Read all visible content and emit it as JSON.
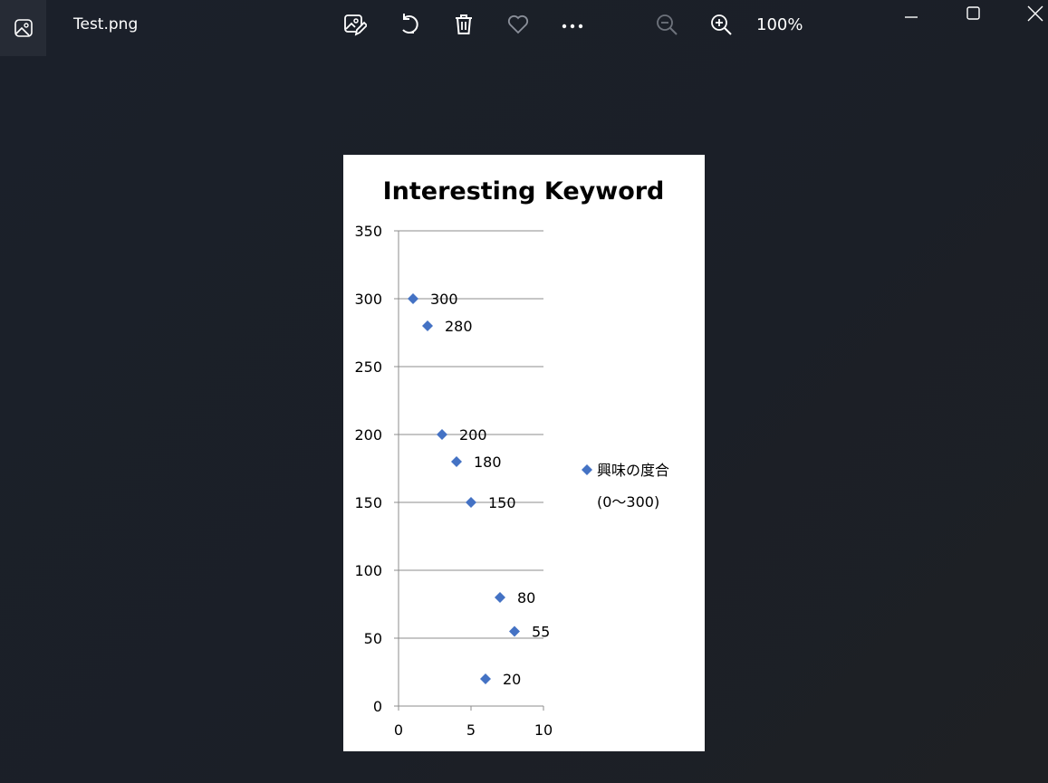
{
  "window": {
    "file_name": "Test.png",
    "zoom_level": "100%"
  },
  "toolbar": {
    "icons": [
      "edit-image-icon",
      "rotate-icon",
      "delete-icon",
      "favorite-icon",
      "more-icon",
      "zoom-out-icon",
      "zoom-in-icon"
    ]
  },
  "window_controls": [
    "minimize-icon",
    "maximize-icon",
    "close-icon"
  ],
  "colors": {
    "background": "#1b202a",
    "marker": "#4472c4",
    "gridline": "#8c8c8c"
  },
  "chart_data": {
    "type": "scatter",
    "title": "Interesting Keyword",
    "xlim": [
      0,
      10
    ],
    "ylim": [
      0,
      350
    ],
    "x_ticks": [
      "0",
      "5",
      "10"
    ],
    "y_ticks": [
      "0",
      "50",
      "100",
      "150",
      "200",
      "250",
      "300",
      "350"
    ],
    "grid": "horizontal",
    "legend_position": "right",
    "series": [
      {
        "name": "興味の度合(0〜300)",
        "marker": "diamond",
        "points": [
          {
            "x": 1,
            "y": 300,
            "label": "300"
          },
          {
            "x": 2,
            "y": 280,
            "label": "280"
          },
          {
            "x": 3,
            "y": 200,
            "label": "200"
          },
          {
            "x": 4,
            "y": 180,
            "label": "180"
          },
          {
            "x": 5,
            "y": 150,
            "label": "150"
          },
          {
            "x": 6,
            "y": 20,
            "label": "20"
          },
          {
            "x": 7,
            "y": 80,
            "label": "80"
          },
          {
            "x": 8,
            "y": 55,
            "label": "55"
          }
        ]
      }
    ],
    "legend_lines": [
      "興味の度合",
      "(0〜300)"
    ]
  }
}
